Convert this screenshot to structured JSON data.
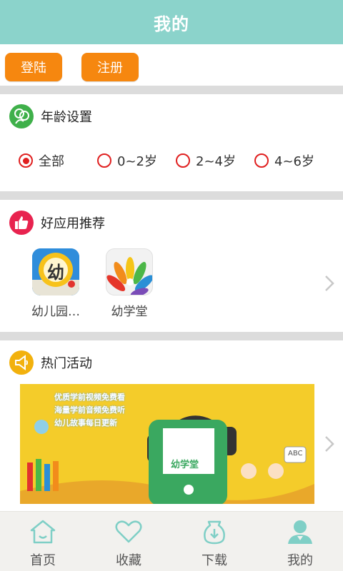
{
  "header": {
    "title": "我的"
  },
  "auth": {
    "login_label": "登陆",
    "register_label": "注册"
  },
  "age_section": {
    "title": "年龄设置",
    "icon": "people-icon",
    "options": [
      {
        "label": "全部",
        "selected": true
      },
      {
        "label": "0~2岁",
        "selected": false
      },
      {
        "label": "2~4岁",
        "selected": false
      },
      {
        "label": "4~6岁",
        "selected": false
      }
    ]
  },
  "recommend_section": {
    "title": "好应用推荐",
    "icon": "thumbs-up-icon",
    "apps": [
      {
        "label": "幼儿园…",
        "icon_text": "幼"
      },
      {
        "label": "幼学堂"
      }
    ]
  },
  "activity_section": {
    "title": "热门活动",
    "icon": "megaphone-icon",
    "banner": {
      "lines": [
        "优质学前视频免费看",
        "海量学前音频免费听",
        "幼儿故事每日更新"
      ],
      "brand": "幼学堂",
      "tag": "ABC"
    }
  },
  "tabbar": {
    "tabs": [
      {
        "label": "首页",
        "icon": "home-icon"
      },
      {
        "label": "收藏",
        "icon": "heart-icon"
      },
      {
        "label": "下载",
        "icon": "download-icon"
      },
      {
        "label": "我的",
        "icon": "user-icon",
        "active": true
      }
    ]
  },
  "colors": {
    "header": "#8bd3cb",
    "accent": "#f6870f",
    "radio": "#e02020",
    "banner": "#f4cc2a",
    "tab_active": "#7fcfc6"
  }
}
